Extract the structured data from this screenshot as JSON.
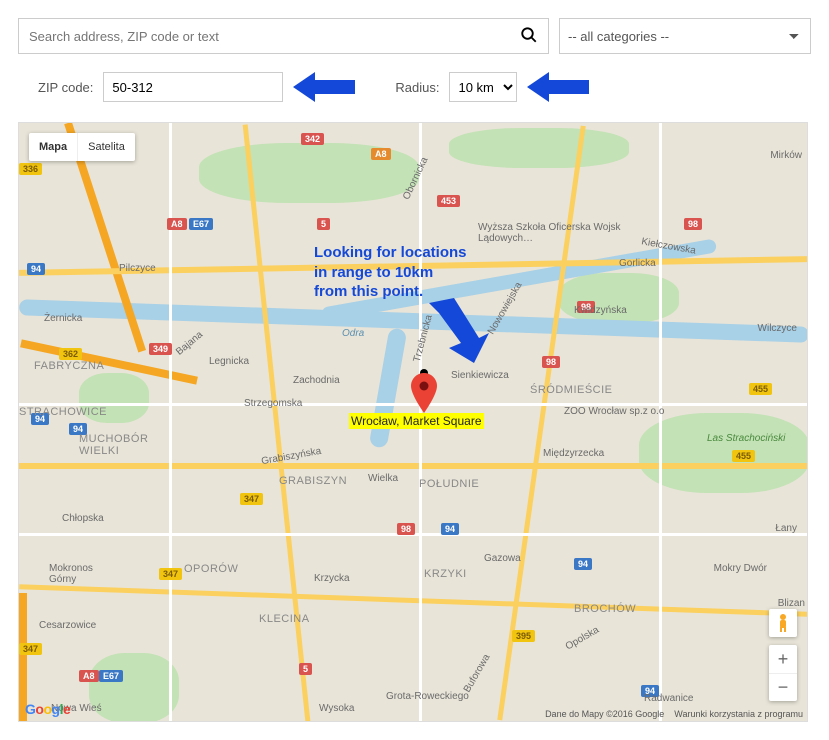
{
  "search": {
    "placeholder": "Search address, ZIP code or text"
  },
  "category": {
    "selected": "-- all categories --"
  },
  "filters": {
    "zip_label": "ZIP code:",
    "zip_value": "50-312",
    "radius_label": "Radius:",
    "radius_value": "10 km"
  },
  "map_controls": {
    "map_label": "Mapa",
    "satellite_label": "Satelita",
    "zoom_in": "+",
    "zoom_out": "−"
  },
  "annotation": {
    "text_line1": "Looking for locations",
    "text_line2": "in range to 10km",
    "text_line3": "from this point."
  },
  "marker": {
    "label": "Wrocław, Market Square"
  },
  "attribution": {
    "data": "Dane do Mapy ©2016 Google",
    "terms": "Warunki korzystania z programu"
  },
  "google_logo": "Google",
  "roads": {
    "a8": "A8",
    "e67": "E67",
    "342": "342",
    "336": "336",
    "94": "94",
    "5": "5",
    "453": "453",
    "349": "349",
    "362": "362",
    "347": "347",
    "98": "98",
    "455": "455",
    "395": "395"
  },
  "places": {
    "mirkow": "Mirków",
    "academy": "Wyższa Szkoła Oficerska Wojsk Lądowych…",
    "kielczowska": "Kiełczowska",
    "gorlicka": "Gorlicka",
    "kwidzynska": "Kwidzyńska",
    "wilczyce": "Wilczyce",
    "pilczyce": "Pilczyce",
    "zernicka": "Żernicka",
    "fabryczna": "FABRYCZNA",
    "strachowice": "STRACHOWICE",
    "bajana": "Bajana",
    "legnicka": "Legnicka",
    "zachodnia": "Zachodnia",
    "odra": "Odra",
    "nowowiejska": "Nowowiejska",
    "trzebn": "Trzebnicka",
    "sienkiewicza": "Sienkiewicza",
    "srodmiesce": "ŚRÓDMIEŚCIE",
    "zoo": "ZOO Wrocław sp.z o.o",
    "las": "Las Strachociński",
    "muchobor": "MUCHOBÓR WIELKI",
    "strzegomska": "Strzegomska",
    "grabiszynska": "Grabiszyńska",
    "grabiszyn": "GRABISZYN",
    "wielka": "Wielka",
    "poludnie": "POŁUDNIE",
    "miedzyrzecka": "Międzyrzecka",
    "chlopska": "Chłopska",
    "mokronos": "Mokronos Górny",
    "oporow": "OPORÓW",
    "klecina": "KLECINA",
    "krzycka": "Krzycka",
    "krzyki": "KRZYKI",
    "gazowa": "Gazowa",
    "brochow": "BROCHÓW",
    "lany": "Łany",
    "mokry": "Mokry Dwór",
    "blizan": "Blizan",
    "cesarzowice": "Cesarzowice",
    "nowa_wies": "Nowa Wieś",
    "wysoka": "Wysoka",
    "opolska": "Opolska",
    "radwanice": "Radwanice",
    "buforowa": "Buforowa",
    "obornicka": "Obornicka",
    "rowecki": "Grota-Roweckiego"
  }
}
